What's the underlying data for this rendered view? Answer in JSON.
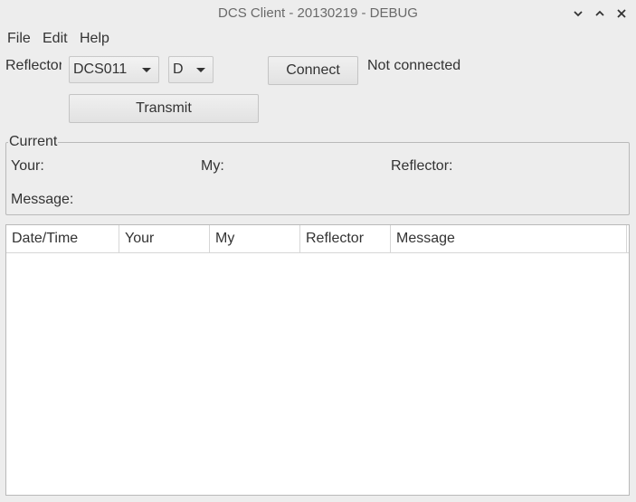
{
  "window": {
    "title": "DCS Client - 20130219 - DEBUG",
    "controls": {
      "minimize_icon": "chevron-down-icon",
      "maximize_icon": "chevron-up-icon",
      "close_icon": "close-icon"
    }
  },
  "menubar": {
    "items": [
      {
        "label": "File"
      },
      {
        "label": "Edit"
      },
      {
        "label": "Help"
      }
    ]
  },
  "controls": {
    "reflector_label": "Reflector:",
    "reflector_value": "DCS011",
    "module_value": "D",
    "connect_label": "Connect",
    "status": "Not connected",
    "transmit_label": "Transmit"
  },
  "current": {
    "title": "Current",
    "your_label": "Your:",
    "my_label": "My:",
    "reflector_label": "Reflector:",
    "message_label": "Message:"
  },
  "table": {
    "columns": [
      "Date/Time",
      "Your",
      "My",
      "Reflector",
      "Message"
    ],
    "rows": []
  },
  "colors": {
    "window_bg": "#ededed",
    "table_bg": "#ffffff",
    "text": "#333333",
    "title_text": "#6a6a6a"
  }
}
